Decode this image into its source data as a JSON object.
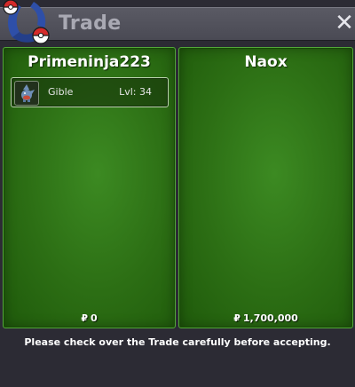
{
  "window": {
    "title": "Trade",
    "close_glyph": "✕"
  },
  "left_panel": {
    "player_name": "Primeninja223",
    "currency_symbol": "₽",
    "money": "0",
    "items": [
      {
        "name": "Gible",
        "level": "Lvl: 34",
        "icon": "gible-icon"
      }
    ]
  },
  "right_panel": {
    "player_name": "Naox",
    "currency_symbol": "₽",
    "money": "1,700,000",
    "items": []
  },
  "footer": {
    "message": "Please check over the Trade carefully before accepting."
  },
  "colors": {
    "panel_green": "#2c6e14",
    "panel_border": "#52a838",
    "background": "#2c2b34",
    "titlebar": "#4f4f59"
  }
}
